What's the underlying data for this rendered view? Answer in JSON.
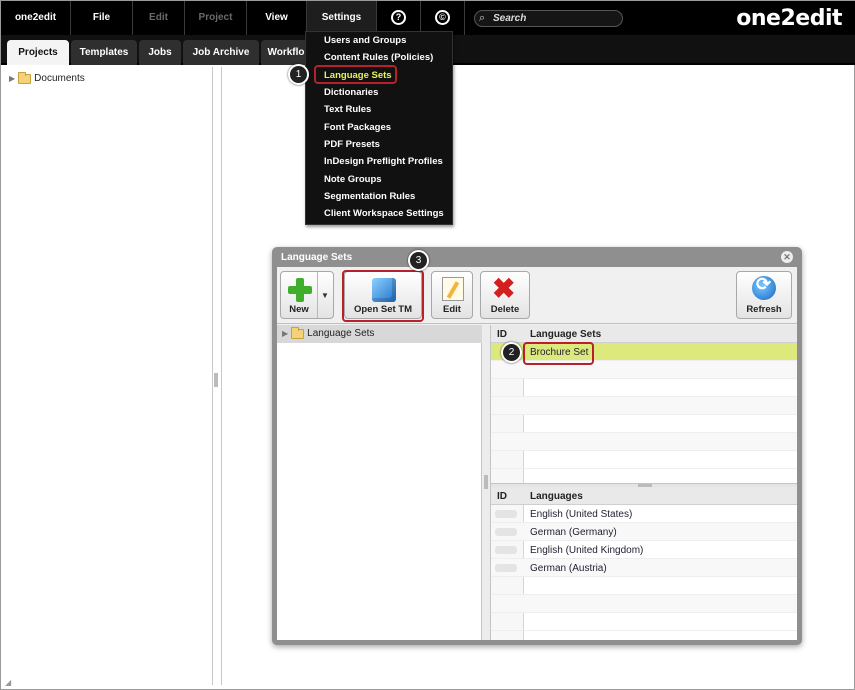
{
  "menubar": {
    "items": [
      {
        "label": "one2edit"
      },
      {
        "label": "File"
      },
      {
        "label": "Edit"
      },
      {
        "label": "Project"
      },
      {
        "label": "View"
      },
      {
        "label": "Settings"
      }
    ],
    "search_placeholder": "Search",
    "logo": "one2edit",
    "help_glyph": "?",
    "copyright_glyph": "©"
  },
  "tabs": [
    {
      "label": "Projects"
    },
    {
      "label": "Templates"
    },
    {
      "label": "Jobs"
    },
    {
      "label": "Job Archive"
    },
    {
      "label": "Workflo"
    }
  ],
  "left_tree": {
    "root": "Documents"
  },
  "settings_menu": {
    "items": [
      "Users and Groups",
      "Content Rules (Policies)",
      "Language Sets",
      "Dictionaries",
      "Text Rules",
      "Font Packages",
      "PDF Presets",
      "InDesign Preflight Profiles",
      "Note Groups",
      "Segmentation Rules",
      "Client Workspace Settings"
    ]
  },
  "callouts": [
    "1",
    "2",
    "3"
  ],
  "dialog": {
    "title": "Language Sets",
    "close_glyph": "✕",
    "toolbar": {
      "new": "New",
      "open_set_tm": "Open Set TM",
      "edit": "Edit",
      "delete": "Delete",
      "refresh": "Refresh"
    },
    "tree_root": "Language Sets",
    "sets_table": {
      "id_header": "ID",
      "name_header": "Language Sets",
      "rows": [
        "Brochure Set"
      ]
    },
    "languages_table": {
      "id_header": "ID",
      "name_header": "Languages",
      "rows": [
        "English (United States)",
        "German (Germany)",
        "English (United Kingdom)",
        "German (Austria)"
      ]
    }
  },
  "colors": {
    "menubar_bg": "#000000",
    "highlight_text": "#e8f25a",
    "callout_border": "#b8202a",
    "selected_row": "#dde97c"
  }
}
